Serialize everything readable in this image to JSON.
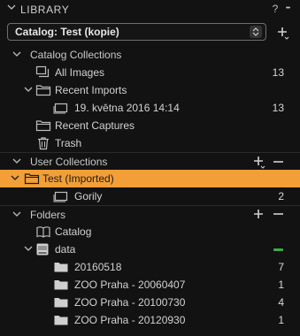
{
  "header": {
    "title": "LIBRARY",
    "help": "?",
    "more": "•••"
  },
  "catalog": {
    "selected": "Catalog: Test (kopie)"
  },
  "catalog_collections": {
    "title": "Catalog Collections",
    "items": [
      {
        "label": "All Images",
        "count": "13"
      },
      {
        "label": "Recent Imports",
        "count": ""
      },
      {
        "label": "19. května 2016 14:14",
        "count": "13"
      },
      {
        "label": "Recent Captures",
        "count": ""
      },
      {
        "label": "Trash",
        "count": ""
      }
    ]
  },
  "user_collections": {
    "title": "User Collections",
    "items": [
      {
        "label": "Test (Imported)",
        "count": ""
      },
      {
        "label": "Gorily",
        "count": "2"
      }
    ]
  },
  "folders": {
    "title": "Folders",
    "items": [
      {
        "label": "Catalog",
        "count": ""
      },
      {
        "label": "data",
        "count": ""
      },
      {
        "label": "20160518",
        "count": "7"
      },
      {
        "label": "ZOO Praha - 20060407",
        "count": "1"
      },
      {
        "label": "ZOO Praha - 20100730",
        "count": "4"
      },
      {
        "label": "ZOO Praha - 20120930",
        "count": "1"
      }
    ]
  },
  "colors": {
    "accent": "#f29f38",
    "status_online": "#3ea84a",
    "background": "#121212"
  }
}
